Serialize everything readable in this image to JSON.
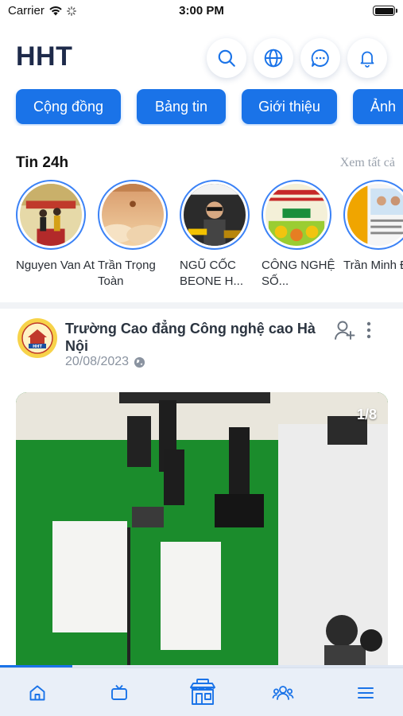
{
  "status": {
    "carrier": "Carrier",
    "time": "3:00 PM"
  },
  "header": {
    "logo": "HHT"
  },
  "tabs": [
    "Cộng đồng",
    "Bảng tin",
    "Giới thiệu",
    "Ảnh"
  ],
  "stories": {
    "title": "Tin 24h",
    "see_all": "Xem tất cả",
    "items": [
      {
        "name": "Nguyen Van At"
      },
      {
        "name": "Trần Trọng Toàn"
      },
      {
        "name": "NGŨ CỐC BEONE H..."
      },
      {
        "name": "CÔNG NGHỆ SỐ..."
      },
      {
        "name": "Trần Minh Đức"
      }
    ]
  },
  "post": {
    "author": "Trường Cao đẳng Công nghệ cao Hà Nội",
    "date": "20/08/2023",
    "avatar_text": "HHT",
    "page_indicator": "1/8",
    "progress": 0.18
  },
  "colors": {
    "primary": "#1a73e8",
    "brand_text": "#1e2a4a",
    "tabbar_bg": "#e9eff8"
  },
  "bottom_nav": [
    "home-icon",
    "tv-icon",
    "store-icon",
    "group-icon",
    "menu-icon"
  ]
}
